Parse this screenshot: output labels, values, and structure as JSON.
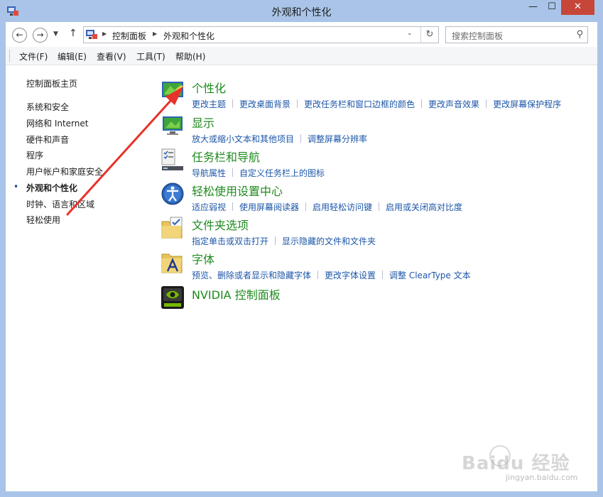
{
  "window": {
    "title": "外观和个性化",
    "min_glyph": "—",
    "max_glyph": "☐",
    "close_glyph": "✕"
  },
  "nav": {
    "back_glyph": "←",
    "forward_glyph": "→",
    "recent_glyph": "▼",
    "up_glyph": "↑",
    "breadcrumb": [
      "控制面板",
      "外观和个性化"
    ],
    "crumb_sep": "▶",
    "dropdown_glyph": "⌄",
    "refresh_glyph": "↻"
  },
  "search": {
    "placeholder": "搜索控制面板",
    "icon_glyph": "⚲"
  },
  "menu": [
    "文件(F)",
    "编辑(E)",
    "查看(V)",
    "工具(T)",
    "帮助(H)"
  ],
  "sidebar": {
    "home": "控制面板主页",
    "items": [
      {
        "label": "系统和安全"
      },
      {
        "label": "网络和 Internet"
      },
      {
        "label": "硬件和声音"
      },
      {
        "label": "程序"
      },
      {
        "label": "用户帐户和家庭安全"
      },
      {
        "label": "外观和个性化",
        "current": true
      },
      {
        "label": "时钟、语言和区域"
      },
      {
        "label": "轻松使用"
      }
    ],
    "bullet": "•"
  },
  "categories": [
    {
      "title": "个性化",
      "links": [
        "更改主题",
        "更改桌面背景",
        "更改任务栏和窗口边框的颜色",
        "更改声音效果",
        "更改屏幕保护程序"
      ]
    },
    {
      "title": "显示",
      "links": [
        "放大或缩小文本和其他项目",
        "调整屏幕分辨率"
      ]
    },
    {
      "title": "任务栏和导航",
      "links": [
        "导航属性",
        "自定义任务栏上的图标"
      ]
    },
    {
      "title": "轻松使用设置中心",
      "links": [
        "适应弱视",
        "使用屏幕阅读器",
        "启用轻松访问键",
        "启用或关闭高对比度"
      ]
    },
    {
      "title": "文件夹选项",
      "links": [
        "指定单击或双击打开",
        "显示隐藏的文件和文件夹"
      ]
    },
    {
      "title": "字体",
      "links": [
        "预览、删除或者显示和隐藏字体",
        "更改字体设置",
        "调整 ClearType 文本"
      ]
    },
    {
      "title": "NVIDIA 控制面板",
      "links": []
    }
  ],
  "watermark": {
    "text": "Baidu 经验",
    "sub": "jingyan.baidu.com"
  },
  "colors": {
    "title_bar": "#a9c4e8",
    "close_button": "#c7463a",
    "category_title": "#1e8a1e",
    "link": "#1c56a8",
    "annotation_arrow": "#e8322a"
  }
}
